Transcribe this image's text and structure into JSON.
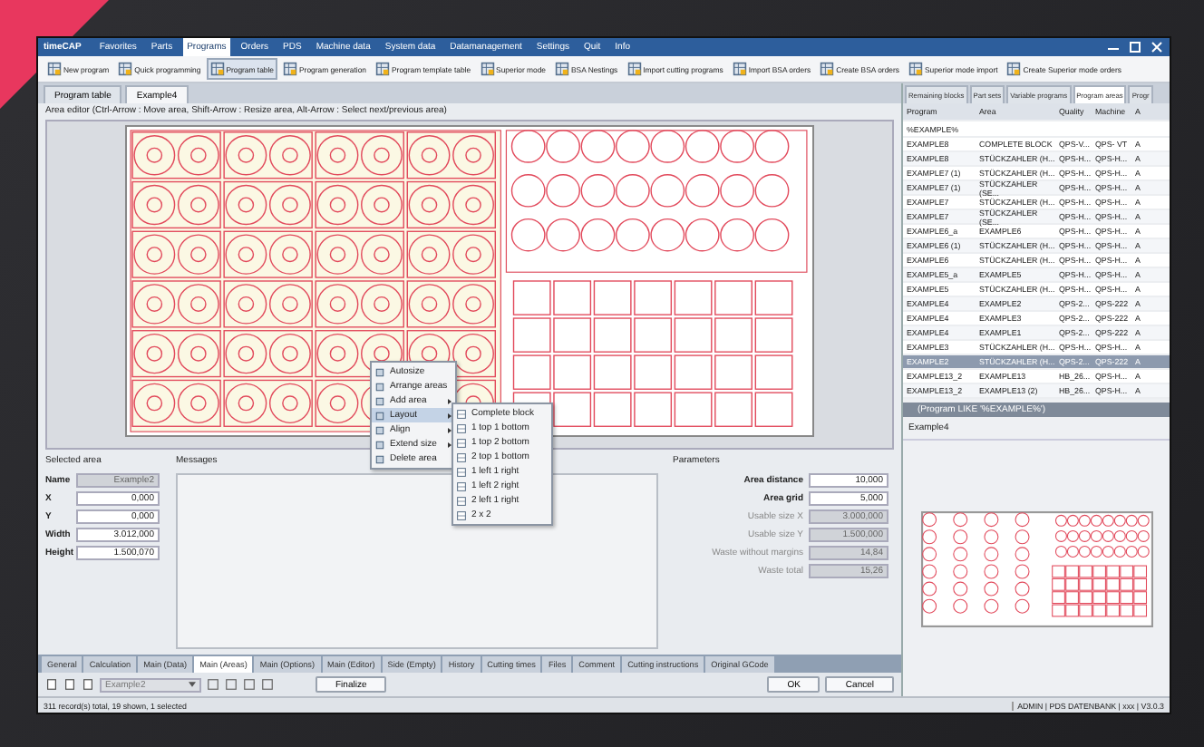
{
  "window": {
    "logo": "timeCAP"
  },
  "menu": [
    {
      "label": "Favorites",
      "selected": false
    },
    {
      "label": "Parts",
      "selected": false
    },
    {
      "label": "Programs",
      "selected": true
    },
    {
      "label": "Orders",
      "selected": false
    },
    {
      "label": "PDS",
      "selected": false
    },
    {
      "label": "Machine data",
      "selected": false
    },
    {
      "label": "System data",
      "selected": false
    },
    {
      "label": "Datamanagement",
      "selected": false
    },
    {
      "label": "Settings",
      "selected": false
    },
    {
      "label": "Quit",
      "selected": false
    },
    {
      "label": "Info",
      "selected": false
    }
  ],
  "toolbar": [
    {
      "label": "New program",
      "selected": false
    },
    {
      "label": "Quick programming",
      "selected": false
    },
    {
      "label": "Program table",
      "selected": true
    },
    {
      "label": "Program generation",
      "selected": false
    },
    {
      "label": "Program template table",
      "selected": false
    },
    {
      "label": "Superior mode",
      "selected": false
    },
    {
      "label": "BSA Nestings",
      "selected": false
    },
    {
      "label": "Import cutting programs",
      "selected": false
    },
    {
      "label": "Import BSA orders",
      "selected": false
    },
    {
      "label": "Create BSA orders",
      "selected": false
    },
    {
      "label": "Superior mode import",
      "selected": false
    },
    {
      "label": "Create Superior mode orders",
      "selected": false
    }
  ],
  "doc_tabs": [
    {
      "label": "Program table",
      "selected": false
    },
    {
      "label": "Example4",
      "selected": true
    }
  ],
  "help_text": "Area editor (Ctrl-Arrow : Move area, Shift-Arrow : Resize area, Alt-Arrow : Select next/previous area)",
  "context_menu": [
    {
      "label": "Autosize",
      "submenu": false,
      "selected": false
    },
    {
      "label": "Arrange areas",
      "submenu": false,
      "selected": false
    },
    {
      "label": "Add area",
      "submenu": true,
      "selected": false
    },
    {
      "label": "Layout",
      "submenu": true,
      "selected": true
    },
    {
      "label": "Align",
      "submenu": true,
      "selected": false
    },
    {
      "label": "Extend size",
      "submenu": true,
      "selected": false
    },
    {
      "label": "Delete area",
      "submenu": false,
      "selected": false
    }
  ],
  "submenu": [
    "Complete block",
    "1 top 1 bottom",
    "1 top 2 bottom",
    "2 top 1 bottom",
    "1 left 1 right",
    "1 left 2 right",
    "2 left 1 right",
    "2 x 2"
  ],
  "selected_area": {
    "title": "Selected area",
    "fields": [
      {
        "label": "Name",
        "value": "Example2",
        "disabled": true
      },
      {
        "label": "X",
        "value": "0,000",
        "disabled": false
      },
      {
        "label": "Y",
        "value": "0,000",
        "disabled": false
      },
      {
        "label": "Width",
        "value": "3.012,000",
        "disabled": false
      },
      {
        "label": "Height",
        "value": "1.500,070",
        "disabled": false
      }
    ]
  },
  "messages": {
    "title": "Messages"
  },
  "parameters": {
    "title": "Parameters",
    "fields": [
      {
        "label": "Area distance",
        "value": "10,000",
        "disabled": false
      },
      {
        "label": "Area grid",
        "value": "5,000",
        "disabled": false
      },
      {
        "label": "Usable size X",
        "value": "3.000,000",
        "disabled": true
      },
      {
        "label": "Usable size Y",
        "value": "1.500,000",
        "disabled": true
      },
      {
        "label": "Waste without margins",
        "value": "14,84",
        "disabled": true
      },
      {
        "label": "Waste total",
        "value": "15,26",
        "disabled": true
      }
    ]
  },
  "bottom_tabs": [
    {
      "label": "General",
      "selected": false
    },
    {
      "label": "Calculation",
      "selected": false
    },
    {
      "label": "Main (Data)",
      "selected": false
    },
    {
      "label": "Main (Areas)",
      "selected": true
    },
    {
      "label": "Main (Options)",
      "selected": false
    },
    {
      "label": "Main (Editor)",
      "selected": false
    },
    {
      "label": "Side (Empty)",
      "selected": false
    },
    {
      "label": "History",
      "selected": false
    },
    {
      "label": "Cutting times",
      "selected": false
    },
    {
      "label": "Files",
      "selected": false
    },
    {
      "label": "Comment",
      "selected": false
    },
    {
      "label": "Cutting instructions",
      "selected": false
    },
    {
      "label": "Original GCode",
      "selected": false
    }
  ],
  "bottom_bar": {
    "area_select": "Example2",
    "finalize": "Finalize",
    "ok": "OK",
    "cancel": "Cancel"
  },
  "right_tabs": [
    {
      "label": "Remaining blocks",
      "selected": false
    },
    {
      "label": "Part sets",
      "selected": false
    },
    {
      "label": "Variable programs",
      "selected": false
    },
    {
      "label": "Program areas",
      "selected": true
    },
    {
      "label": "Progr",
      "selected": false
    }
  ],
  "table": {
    "columns": [
      "Program",
      "Area",
      "Quality",
      "Machine",
      "A"
    ],
    "filter": "%EXAMPLE%",
    "rows": [
      {
        "cells": [
          "EXAMPLE8",
          "COMPLETE BLOCK",
          "QPS-V...",
          "QPS- VT",
          "A"
        ],
        "selected": false
      },
      {
        "cells": [
          "EXAMPLE8",
          "STÜCKZAHLER (H...",
          "QPS-H...",
          "QPS-H...",
          "A"
        ],
        "selected": false
      },
      {
        "cells": [
          "EXAMPLE7 (1)",
          "STÜCKZAHLER (H...",
          "QPS-H...",
          "QPS-H...",
          "A"
        ],
        "selected": false
      },
      {
        "cells": [
          "EXAMPLE7 (1)",
          "STÜCKZAHLER (SE...",
          "QPS-H...",
          "QPS-H...",
          "A"
        ],
        "selected": false
      },
      {
        "cells": [
          "EXAMPLE7",
          "STÜCKZAHLER (H...",
          "QPS-H...",
          "QPS-H...",
          "A"
        ],
        "selected": false
      },
      {
        "cells": [
          "EXAMPLE7",
          "STÜCKZAHLER (SE...",
          "QPS-H...",
          "QPS-H...",
          "A"
        ],
        "selected": false
      },
      {
        "cells": [
          "EXAMPLE6_a",
          "EXAMPLE6",
          "QPS-H...",
          "QPS-H...",
          "A"
        ],
        "selected": false
      },
      {
        "cells": [
          "EXAMPLE6 (1)",
          "STÜCKZAHLER (H...",
          "QPS-H...",
          "QPS-H...",
          "A"
        ],
        "selected": false
      },
      {
        "cells": [
          "EXAMPLE6",
          "STÜCKZAHLER (H...",
          "QPS-H...",
          "QPS-H...",
          "A"
        ],
        "selected": false
      },
      {
        "cells": [
          "EXAMPLE5_a",
          "EXAMPLE5",
          "QPS-H...",
          "QPS-H...",
          "A"
        ],
        "selected": false
      },
      {
        "cells": [
          "EXAMPLE5",
          "STÜCKZAHLER (H...",
          "QPS-H...",
          "QPS-H...",
          "A"
        ],
        "selected": false
      },
      {
        "cells": [
          "EXAMPLE4",
          "EXAMPLE2",
          "QPS-2...",
          "QPS-222",
          "A"
        ],
        "selected": false
      },
      {
        "cells": [
          "EXAMPLE4",
          "EXAMPLE3",
          "QPS-2...",
          "QPS-222",
          "A"
        ],
        "selected": false
      },
      {
        "cells": [
          "EXAMPLE4",
          "EXAMPLE1",
          "QPS-2...",
          "QPS-222",
          "A"
        ],
        "selected": false
      },
      {
        "cells": [
          "EXAMPLE3",
          "STÜCKZAHLER (H...",
          "QPS-H...",
          "QPS-H...",
          "A"
        ],
        "selected": false
      },
      {
        "cells": [
          "EXAMPLE2",
          "STÜCKZAHLER (H...",
          "QPS-2...",
          "QPS-222",
          "A"
        ],
        "selected": true
      },
      {
        "cells": [
          "EXAMPLE13_2",
          "EXAMPLE13",
          "HB_26...",
          "QPS-H...",
          "A"
        ],
        "selected": false
      },
      {
        "cells": [
          "EXAMPLE13_2",
          "EXAMPLE13 (2)",
          "HB_26...",
          "QPS-H...",
          "A"
        ],
        "selected": false
      }
    ],
    "filter_expression": "(Program LIKE '%EXAMPLE%')"
  },
  "preview": {
    "title": "Example4"
  },
  "status_bar": {
    "left": "311 record(s) total, 19 shown, 1 selected",
    "right": "ADMIN | PDS DATENBANK | xxx | V3.0.3"
  }
}
